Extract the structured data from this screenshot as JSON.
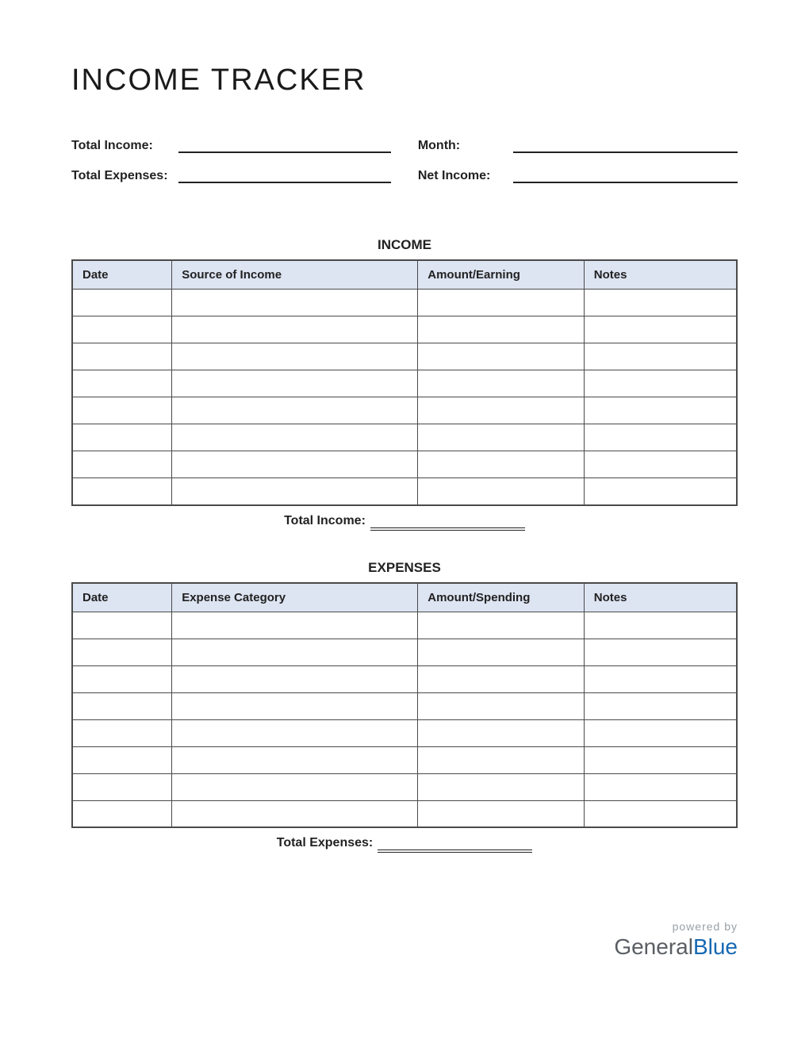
{
  "title": "INCOME TRACKER",
  "summary": {
    "total_income_label": "Total Income:",
    "total_expenses_label": "Total Expenses:",
    "month_label": "Month:",
    "net_income_label": "Net Income:"
  },
  "income": {
    "section_title": "INCOME",
    "headers": {
      "date": "Date",
      "source": "Source of Income",
      "amount": "Amount/Earning",
      "notes": "Notes"
    },
    "rows": 8,
    "total_label": "Total Income:"
  },
  "expenses": {
    "section_title": "EXPENSES",
    "headers": {
      "date": "Date",
      "category": "Expense Category",
      "amount": "Amount/Spending",
      "notes": "Notes"
    },
    "rows": 8,
    "total_label": "Total Expenses:"
  },
  "footer": {
    "powered_by": "powered by",
    "brand_part1": "General",
    "brand_part2": "Blue"
  }
}
